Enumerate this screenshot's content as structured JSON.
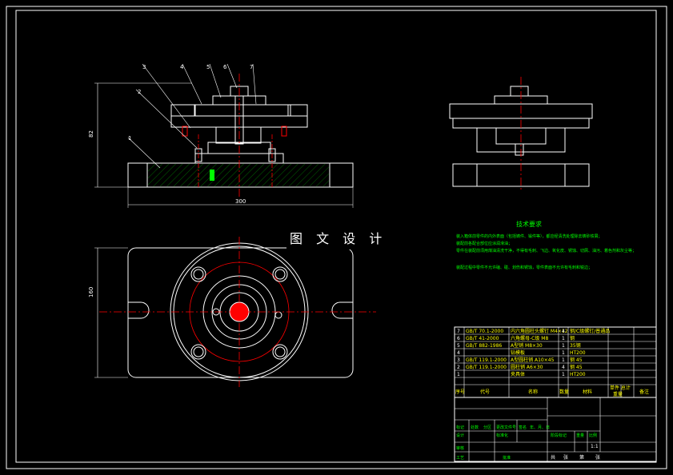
{
  "watermark": "图 文 设 计",
  "part_numbers": [
    "1",
    "2",
    "3",
    "4",
    "5",
    "6",
    "7"
  ],
  "tech_req": {
    "title": "技术要求",
    "lines": [
      "装入箱体前零件的内外表面（包括铸件、锻件等），都应经清洗处理除去铸砂铁屑；",
      "装配前各配合部位应涂润滑油；",
      "零件在装配前须用煤油清洗干净，不得有毛刺、飞边、氧化皮、锈蚀、切屑、油污、着色剂和灰尘等；",
      "装配过程中零件不允许磕、碰、划伤和锈蚀，零件表面不允许有毛刺和锐边；"
    ]
  },
  "bom_rows": [
    {
      "no": "7",
      "code": "GB/T 70.1-2000",
      "name": "内六角圆柱头螺钉 M4×12",
      "qty": "4",
      "material": "钢/C级螺钉/普通品",
      "note": ""
    },
    {
      "no": "6",
      "code": "GB/T 41-2000",
      "name": "六角螺母-C级 M8",
      "qty": "1",
      "material": "钢",
      "note": ""
    },
    {
      "no": "5",
      "code": "GB/T 882-1986",
      "name": "A型销 M8×30",
      "qty": "1",
      "material": "35钢",
      "note": ""
    },
    {
      "no": "4",
      "code": "",
      "name": "钻模板",
      "qty": "1",
      "material": "HT200",
      "note": ""
    },
    {
      "no": "3",
      "code": "GB/T 119.1-2000",
      "name": "A型圆柱销 A10×45",
      "qty": "1",
      "material": "钢 45",
      "note": ""
    },
    {
      "no": "2",
      "code": "GB/T 119.1-2000",
      "name": "圆柱销 A6×30",
      "qty": "4",
      "material": "钢 45",
      "note": ""
    },
    {
      "no": "1",
      "code": "",
      "name": "夹具体",
      "qty": "1",
      "material": "HT200",
      "note": ""
    }
  ],
  "bom_header": {
    "no": "序号",
    "code": "代号",
    "name": "名称",
    "qty": "数量",
    "material": "材料",
    "unit_total": "单件 总计",
    "weight": "重量",
    "note": "备注"
  },
  "title_block": {
    "row_a": [
      "标记",
      "处数",
      "分区",
      "更改文件号",
      "签名",
      "年、月、日"
    ],
    "row_b": [
      "设计",
      "",
      "标准化",
      "",
      "阶段标记",
      "重量",
      "比例"
    ],
    "row_c": [
      "审核"
    ],
    "row_d": [
      "工艺",
      "",
      "批准"
    ],
    "row_e": [
      "共",
      "张",
      "第",
      "张"
    ],
    "scale": "1:1"
  },
  "dims": {
    "width": "300",
    "height_top": "82",
    "height_bottom": "160"
  }
}
